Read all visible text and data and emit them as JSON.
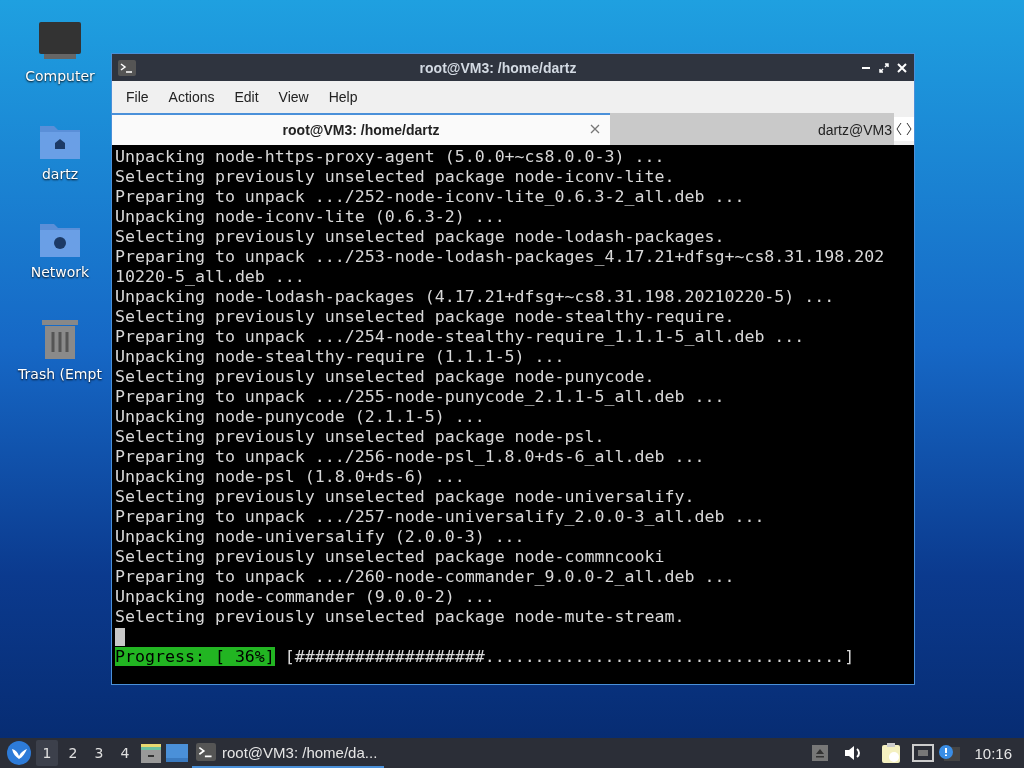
{
  "desktop": {
    "icons": [
      {
        "label": "Computer",
        "kind": "computer"
      },
      {
        "label": "dartz",
        "kind": "home"
      },
      {
        "label": "Network",
        "kind": "network"
      },
      {
        "label": "Trash (Empt",
        "kind": "trash"
      }
    ]
  },
  "window": {
    "title": "root@VM3: /home/dartz",
    "menu": [
      "File",
      "Actions",
      "Edit",
      "View",
      "Help"
    ],
    "tabs": [
      {
        "label": "root@VM3: /home/dartz",
        "selected": true
      },
      {
        "label": "dartz@VM3",
        "selected": false
      }
    ],
    "terminal": {
      "lines": [
        "Unpacking node-https-proxy-agent (5.0.0+~cs8.0.0-3) ...",
        "Selecting previously unselected package node-iconv-lite.",
        "Preparing to unpack .../252-node-iconv-lite_0.6.3-2_all.deb ...",
        "Unpacking node-iconv-lite (0.6.3-2) ...",
        "Selecting previously unselected package node-lodash-packages.",
        "Preparing to unpack .../253-node-lodash-packages_4.17.21+dfsg+~cs8.31.198.202",
        "10220-5_all.deb ...",
        "Unpacking node-lodash-packages (4.17.21+dfsg+~cs8.31.198.20210220-5) ...",
        "Selecting previously unselected package node-stealthy-require.",
        "Preparing to unpack .../254-node-stealthy-require_1.1.1-5_all.deb ...",
        "Unpacking node-stealthy-require (1.1.1-5) ...",
        "Selecting previously unselected package node-punycode.",
        "Preparing to unpack .../255-node-punycode_2.1.1-5_all.deb ...",
        "Unpacking node-punycode (2.1.1-5) ...",
        "Selecting previously unselected package node-psl.",
        "Preparing to unpack .../256-node-psl_1.8.0+ds-6_all.deb ...",
        "Unpacking node-psl (1.8.0+ds-6) ...",
        "Selecting previously unselected package node-universalify.",
        "Preparing to unpack .../257-node-universalify_2.0.0-3_all.deb ...",
        "Unpacking node-universalify (2.0.0-3) ...",
        "Selecting previously unselected package node-commncooki",
        "Preparing to unpack .../260-node-commander_9.0.0-2_all.deb ...",
        "Unpacking node-commander (9.0.0-2) ...",
        "Selecting previously unselected package node-mute-stream."
      ],
      "progress": {
        "label": "Progress: [ 36%]",
        "bar": "[###################....................................]"
      }
    }
  },
  "taskbar": {
    "workspaces": [
      {
        "label": "1",
        "selected": true
      },
      {
        "label": "2",
        "selected": false
      },
      {
        "label": "3",
        "selected": false
      },
      {
        "label": "4",
        "selected": false
      }
    ],
    "tasks": [
      {
        "label": "root@VM3: /home/da...",
        "selected": true
      }
    ],
    "clock": "10:16"
  }
}
